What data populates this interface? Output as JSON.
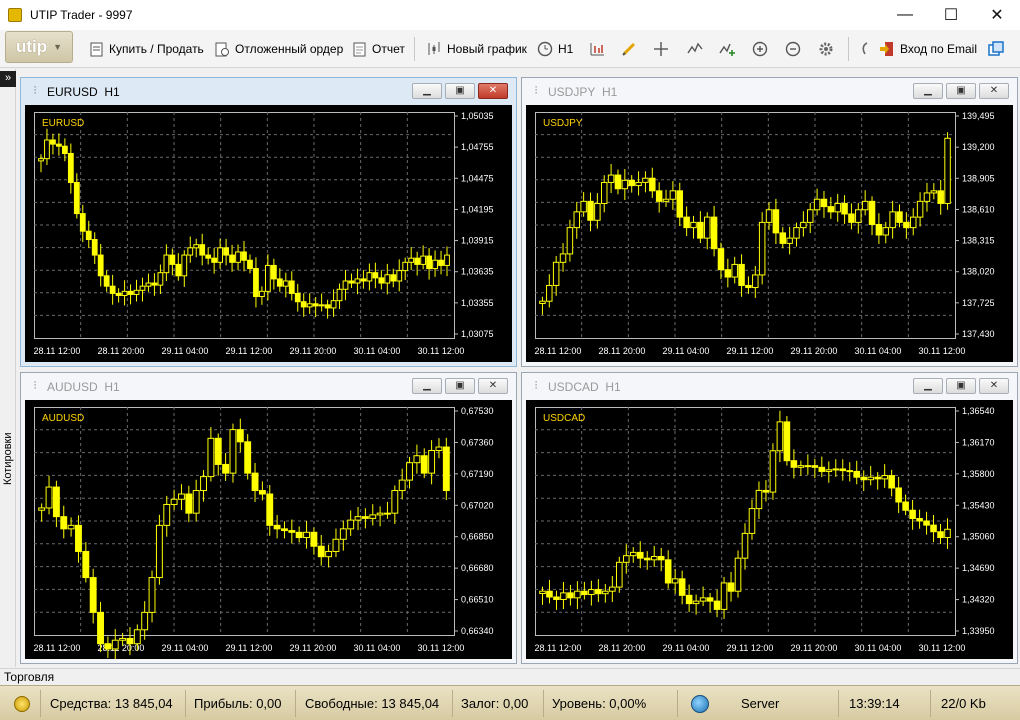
{
  "window": {
    "title": "UTIP Trader - 9997",
    "minimize_glyph": "—",
    "maximize_glyph": "☐",
    "close_glyph": "✕"
  },
  "toolbar": {
    "logo": "utip",
    "logo_caret": "▼",
    "buy_sell": "Купить / Продать",
    "pending_order": "Отложенный ордер",
    "report": "Отчет",
    "new_chart": "Новый график",
    "timeframe": "H1",
    "email_login": "Вход по Email",
    "icons": [
      "buy-sell-icon",
      "pending-order-icon",
      "report-icon",
      "new-chart-icon",
      "clock-icon",
      "bar-chart-icon",
      "pencil-icon",
      "crosshair-icon",
      "indicator-icon",
      "indicator-add-icon",
      "zoom-in-icon",
      "zoom-out-icon",
      "settings-icon",
      "tools-icon",
      "login-icon",
      "windows-icon"
    ]
  },
  "side_panel": {
    "expand_glyph": "»",
    "label": "Котировки"
  },
  "charts": [
    {
      "symbol": "EURUSD",
      "timeframe": "H1",
      "active": true,
      "price_labels": [
        "1,05035",
        "1,04755",
        "1,04475",
        "1,04195",
        "1,03915",
        "1,03635",
        "1,03355",
        "1,03075"
      ],
      "time_labels": [
        "28.11 12:00",
        "28.11 20:00",
        "29.11 04:00",
        "29.11 12:00",
        "29.11 20:00",
        "30.11 04:00",
        "30.11 12:00"
      ],
      "ylim": [
        1.0295,
        1.0513
      ],
      "series": [
        1.0468,
        1.0486,
        1.0482,
        1.048,
        1.0473,
        1.0445,
        1.0415,
        1.0398,
        1.039,
        1.0375,
        1.0355,
        1.0345,
        1.0338,
        1.0336,
        1.034,
        1.0337,
        1.0341,
        1.0345,
        1.0348,
        1.0346,
        1.0358,
        1.0375,
        1.0366,
        1.0355,
        1.0375,
        1.0382,
        1.0385,
        1.0375,
        1.0372,
        1.0368,
        1.0382,
        1.0375,
        1.0368,
        1.0378,
        1.037,
        1.0362,
        1.0335,
        1.034,
        1.0365,
        1.0352,
        1.0345,
        1.035,
        1.0338,
        1.033,
        1.0325,
        1.0328,
        1.0326,
        1.0327,
        1.0324,
        1.0331,
        1.0342,
        1.035,
        1.0348,
        1.0352,
        1.035,
        1.0358,
        1.0353,
        1.0348,
        1.0356,
        1.035,
        1.036,
        1.0368,
        1.0372,
        1.0366,
        1.0374,
        1.0362,
        1.037,
        1.0365,
        1.0375
      ]
    },
    {
      "symbol": "USDJPY",
      "timeframe": "H1",
      "active": false,
      "price_labels": [
        "139,495",
        "139,200",
        "138,905",
        "138,610",
        "138,315",
        "138,020",
        "137,725",
        "137,430"
      ],
      "time_labels": [
        "28.11 12:00",
        "28.11 20:00",
        "29.11 04:00",
        "29.11 12:00",
        "29.11 20:00",
        "30.11 04:00",
        "30.11 12:00"
      ],
      "ylim": [
        137.4,
        139.55
      ],
      "series": [
        137.75,
        137.9,
        138.12,
        138.2,
        138.45,
        138.6,
        138.7,
        138.52,
        138.68,
        138.88,
        138.95,
        138.82,
        138.9,
        138.85,
        138.88,
        138.92,
        138.8,
        138.7,
        138.72,
        138.8,
        138.55,
        138.45,
        138.5,
        138.35,
        138.55,
        138.25,
        138.05,
        137.98,
        138.1,
        137.9,
        137.88,
        138.0,
        138.5,
        138.62,
        138.4,
        138.3,
        138.35,
        138.45,
        138.5,
        138.62,
        138.72,
        138.65,
        138.6,
        138.68,
        138.58,
        138.5,
        138.62,
        138.7,
        138.48,
        138.38,
        138.45,
        138.6,
        138.5,
        138.45,
        138.55,
        138.7,
        138.78,
        138.8,
        138.68,
        139.3
      ]
    },
    {
      "symbol": "AUDUSD",
      "timeframe": "H1",
      "active": false,
      "price_labels": [
        "0,67530",
        "0,67360",
        "0,67190",
        "0,67020",
        "0,66850",
        "0,66680",
        "0,66510",
        "0,66340"
      ],
      "time_labels": [
        "28.11 12:00",
        "28.11 20:00",
        "29.11 04:00",
        "29.11 12:00",
        "29.11 20:00",
        "30.11 04:00",
        "30.11 12:00"
      ],
      "ylim": [
        0.6627,
        0.6758
      ],
      "series": [
        0.67,
        0.6712,
        0.6695,
        0.6688,
        0.669,
        0.6675,
        0.666,
        0.664,
        0.6622,
        0.6619,
        0.6624,
        0.6625,
        0.6622,
        0.663,
        0.664,
        0.666,
        0.669,
        0.6702,
        0.6705,
        0.6708,
        0.6697,
        0.671,
        0.6718,
        0.674,
        0.6725,
        0.672,
        0.6745,
        0.6738,
        0.672,
        0.671,
        0.6708,
        0.669,
        0.6688,
        0.6687,
        0.6686,
        0.6683,
        0.6686,
        0.6678,
        0.6672,
        0.6675,
        0.6682,
        0.6688,
        0.6693,
        0.6695,
        0.6694,
        0.6696,
        0.6697,
        0.6697,
        0.671,
        0.6716,
        0.6726,
        0.673,
        0.672,
        0.6733,
        0.6735,
        0.671
      ]
    },
    {
      "symbol": "USDCAD",
      "timeframe": "H1",
      "active": false,
      "price_labels": [
        "1,36540",
        "1,36170",
        "1,35800",
        "1,35430",
        "1,35060",
        "1,34690",
        "1,34320",
        "1,33950"
      ],
      "time_labels": [
        "28.11 12:00",
        "28.11 20:00",
        "29.11 04:00",
        "29.11 12:00",
        "29.11 20:00",
        "30.11 04:00",
        "30.11 12:00"
      ],
      "ylim": [
        1.3387,
        1.3663
      ],
      "series": [
        1.344,
        1.3433,
        1.343,
        1.3438,
        1.3432,
        1.344,
        1.3436,
        1.3442,
        1.3437,
        1.344,
        1.3445,
        1.3475,
        1.3483,
        1.3487,
        1.348,
        1.3478,
        1.3482,
        1.3478,
        1.345,
        1.3455,
        1.3435,
        1.3425,
        1.3428,
        1.3432,
        1.3428,
        1.3418,
        1.345,
        1.344,
        1.348,
        1.351,
        1.354,
        1.3562,
        1.356,
        1.361,
        1.3645,
        1.3598,
        1.359,
        1.3592,
        1.3592,
        1.359,
        1.3585,
        1.3587,
        1.3588,
        1.3586,
        1.3585,
        1.3578,
        1.3575,
        1.3578,
        1.3576,
        1.358,
        1.3565,
        1.3548,
        1.3538,
        1.3528,
        1.3525,
        1.352,
        1.3512,
        1.3505,
        1.3515
      ]
    }
  ],
  "trade_tab": "Торговля",
  "status": {
    "funds": "Средства: 13 845,04",
    "profit": "Прибыль: 0,00",
    "free": "Свободные: 13 845,04",
    "margin": "Залог: 0,00",
    "level": "Уровень: 0,00%",
    "server": "Server",
    "time": "13:39:14",
    "traffic": "22/0 Kb"
  },
  "colors": {
    "candle": "#ffff00",
    "grid": "#6a6a6a",
    "axis_text": "#ffffff",
    "symbol_label": "#ffd400",
    "active_close": "#c13b2a"
  }
}
